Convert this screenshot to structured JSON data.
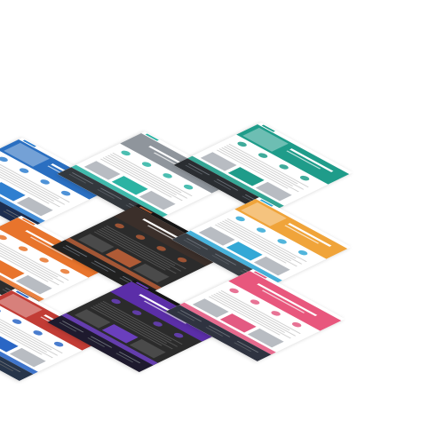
{
  "title": "",
  "mockups": [
    {
      "name": "mockup-blue-hero",
      "accent": "#2f7fd0",
      "hero": "#2a6fc1",
      "dark": "#1c2d4f",
      "style": "hero-left"
    },
    {
      "name": "mockup-city-skyline",
      "accent": "#2bb3a3",
      "hero": "#8f959c",
      "dark": "#33383d",
      "style": "band"
    },
    {
      "name": "mockup-green-header",
      "accent": "#1f9c8a",
      "hero": "#1f9c8a",
      "dark": "#2a2d31",
      "style": "hero-left"
    },
    {
      "name": "mockup-orange-hero",
      "accent": "#e8742c",
      "hero": "#e8742c",
      "dark": "#2d2d2d",
      "style": "band"
    },
    {
      "name": "mockup-dark-theme",
      "accent": "#b05b36",
      "hero": "#3b2f2a",
      "dark": "#212121",
      "style": "dark"
    },
    {
      "name": "mockup-teal-light",
      "accent": "#33a8d6",
      "hero": "#f0a43a",
      "dark": "#3a3f45",
      "style": "hero-left"
    },
    {
      "name": "mockup-red-blue-store",
      "accent": "#2a66c5",
      "hero": "#c23c35",
      "dark": "#27354a",
      "style": "hero-left"
    },
    {
      "name": "mockup-purple-event",
      "accent": "#6a3fbd",
      "hero": "#5b2ea8",
      "dark": "#1e1a2e",
      "style": "dark"
    },
    {
      "name": "mockup-pink-app",
      "accent": "#e35a82",
      "hero": "#e8577d",
      "dark": "#2f3340",
      "style": "band"
    }
  ]
}
